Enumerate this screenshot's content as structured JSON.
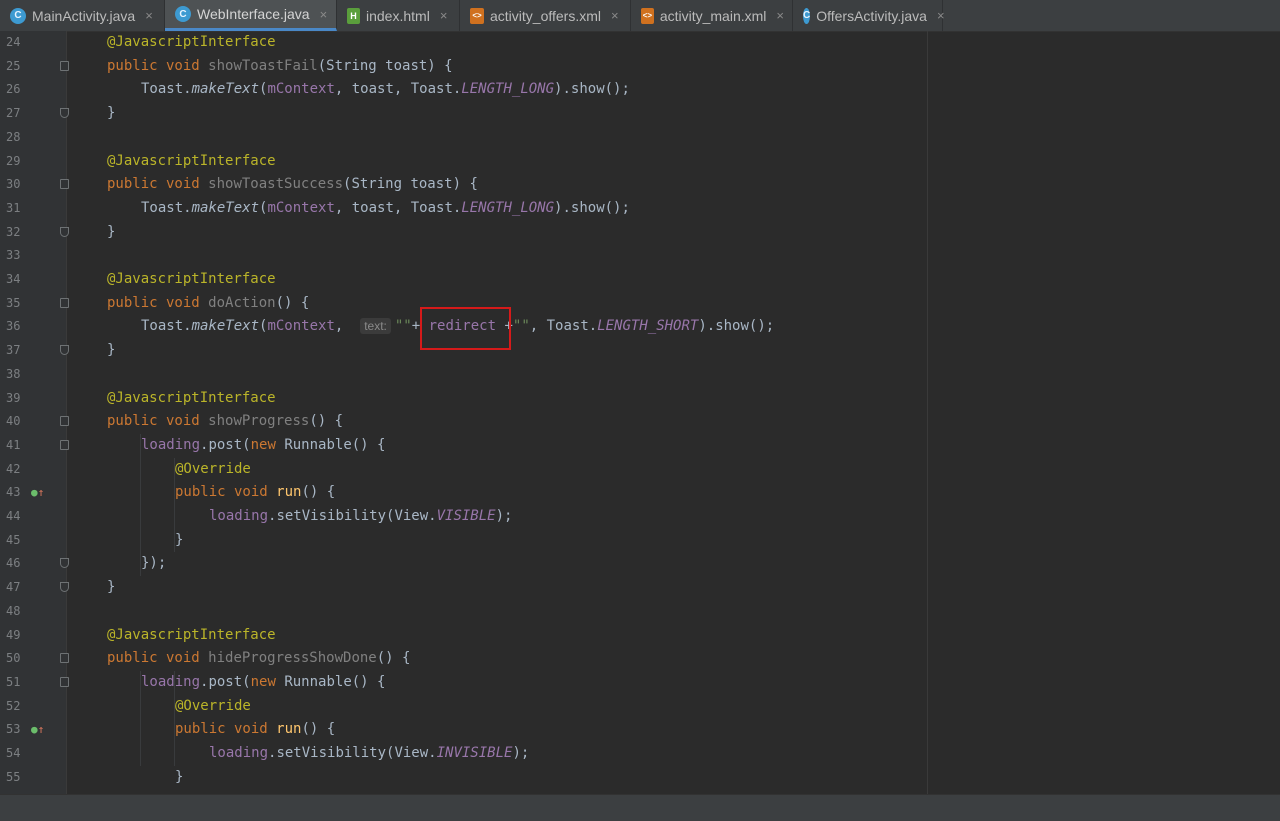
{
  "tabs": [
    {
      "label": "MainActivity.java",
      "icon": "java-class-icon",
      "active": false,
      "closable": true
    },
    {
      "label": "WebInterface.java",
      "icon": "java-class-icon",
      "active": true,
      "closable": true
    },
    {
      "label": "index.html",
      "icon": "html-file-icon",
      "active": false,
      "closable": true
    },
    {
      "label": "activity_offers.xml",
      "icon": "xml-file-icon",
      "active": false,
      "closable": true
    },
    {
      "label": "activity_main.xml",
      "icon": "xml-file-icon",
      "active": false,
      "closable": true
    },
    {
      "label": "OffersActivity.java",
      "icon": "java-class-icon",
      "active": false,
      "closable": true
    }
  ],
  "tab_close_glyph": "×",
  "editor": {
    "hint_text": "text:",
    "lines": [
      {
        "n": "24",
        "fold": "",
        "mark": false,
        "indent": 0,
        "tokens": [
          [
            "ann",
            "@JavascriptInterface"
          ]
        ]
      },
      {
        "n": "25",
        "fold": "start",
        "mark": false,
        "indent": 0,
        "tokens": [
          [
            "kw",
            "public void "
          ],
          [
            "unused",
            "showToastFail"
          ],
          [
            "",
            "(String toast) {"
          ]
        ]
      },
      {
        "n": "26",
        "fold": "",
        "mark": false,
        "indent": 1,
        "tokens": [
          [
            "",
            "Toast."
          ],
          [
            "stat",
            "makeText"
          ],
          [
            "",
            "("
          ],
          [
            "field",
            "mContext"
          ],
          [
            "",
            ", toast, Toast."
          ],
          [
            "sfield",
            "LENGTH_LONG"
          ],
          [
            "",
            ").show();"
          ]
        ]
      },
      {
        "n": "27",
        "fold": "end",
        "mark": false,
        "indent": 0,
        "tokens": [
          [
            "",
            "}"
          ]
        ]
      },
      {
        "n": "28",
        "fold": "",
        "mark": false,
        "indent": 0,
        "tokens": []
      },
      {
        "n": "29",
        "fold": "",
        "mark": false,
        "indent": 0,
        "tokens": [
          [
            "ann",
            "@JavascriptInterface"
          ]
        ]
      },
      {
        "n": "30",
        "fold": "start",
        "mark": false,
        "indent": 0,
        "tokens": [
          [
            "kw",
            "public void "
          ],
          [
            "unused",
            "showToastSuccess"
          ],
          [
            "",
            "(String toast) {"
          ]
        ]
      },
      {
        "n": "31",
        "fold": "",
        "mark": false,
        "indent": 1,
        "tokens": [
          [
            "",
            "Toast."
          ],
          [
            "stat",
            "makeText"
          ],
          [
            "",
            "("
          ],
          [
            "field",
            "mContext"
          ],
          [
            "",
            ", toast, Toast."
          ],
          [
            "sfield",
            "LENGTH_LONG"
          ],
          [
            "",
            ").show();"
          ]
        ]
      },
      {
        "n": "32",
        "fold": "end",
        "mark": false,
        "indent": 0,
        "tokens": [
          [
            "",
            "}"
          ]
        ]
      },
      {
        "n": "33",
        "fold": "",
        "mark": false,
        "indent": 0,
        "tokens": []
      },
      {
        "n": "34",
        "fold": "",
        "mark": false,
        "indent": 0,
        "tokens": [
          [
            "ann",
            "@JavascriptInterface"
          ]
        ]
      },
      {
        "n": "35",
        "fold": "start",
        "mark": false,
        "indent": 0,
        "tokens": [
          [
            "kw",
            "public void "
          ],
          [
            "unused",
            "doAction"
          ],
          [
            "",
            "() {"
          ]
        ]
      },
      {
        "n": "36",
        "fold": "",
        "mark": false,
        "indent": 1,
        "tokens": [
          [
            "",
            "Toast."
          ],
          [
            "stat",
            "makeText"
          ],
          [
            "",
            "("
          ],
          [
            "field",
            "mContext"
          ],
          [
            "",
            ",  "
          ],
          [
            "hint",
            "text:"
          ],
          [
            "str",
            "\"\""
          ],
          [
            "",
            "+ "
          ],
          [
            "field",
            "redirect"
          ],
          [
            "",
            " +"
          ],
          [
            "str",
            "\"\""
          ],
          [
            "",
            ", Toast."
          ],
          [
            "sfield",
            "LENGTH_SHORT"
          ],
          [
            "",
            ").show();"
          ]
        ]
      },
      {
        "n": "37",
        "fold": "end",
        "mark": false,
        "indent": 0,
        "tokens": [
          [
            "",
            "}"
          ]
        ]
      },
      {
        "n": "38",
        "fold": "",
        "mark": false,
        "indent": 0,
        "tokens": []
      },
      {
        "n": "39",
        "fold": "",
        "mark": false,
        "indent": 0,
        "tokens": [
          [
            "ann",
            "@JavascriptInterface"
          ]
        ]
      },
      {
        "n": "40",
        "fold": "start",
        "mark": false,
        "indent": 0,
        "tokens": [
          [
            "kw",
            "public void "
          ],
          [
            "unused",
            "showProgress"
          ],
          [
            "",
            "() {"
          ]
        ]
      },
      {
        "n": "41",
        "fold": "start",
        "mark": false,
        "indent": 1,
        "tokens": [
          [
            "field",
            "loading"
          ],
          [
            "",
            ".post("
          ],
          [
            "kw",
            "new "
          ],
          [
            "",
            "Runnable() {"
          ]
        ]
      },
      {
        "n": "42",
        "fold": "",
        "mark": false,
        "indent": 2,
        "tokens": [
          [
            "ann",
            "@Override"
          ]
        ]
      },
      {
        "n": "43",
        "fold": "",
        "mark": true,
        "indent": 2,
        "tokens": [
          [
            "kw",
            "public void "
          ],
          [
            "meth",
            "run"
          ],
          [
            "",
            "() {"
          ]
        ]
      },
      {
        "n": "44",
        "fold": "",
        "mark": false,
        "indent": 3,
        "tokens": [
          [
            "field",
            "loading"
          ],
          [
            "",
            ".setVisibility(View."
          ],
          [
            "sfield",
            "VISIBLE"
          ],
          [
            "",
            ");"
          ]
        ]
      },
      {
        "n": "45",
        "fold": "",
        "mark": false,
        "indent": 2,
        "tokens": [
          [
            "",
            "}"
          ]
        ]
      },
      {
        "n": "46",
        "fold": "end",
        "mark": false,
        "indent": 1,
        "tokens": [
          [
            "",
            "});"
          ]
        ]
      },
      {
        "n": "47",
        "fold": "end",
        "mark": false,
        "indent": 0,
        "tokens": [
          [
            "",
            "}"
          ]
        ]
      },
      {
        "n": "48",
        "fold": "",
        "mark": false,
        "indent": 0,
        "tokens": []
      },
      {
        "n": "49",
        "fold": "",
        "mark": false,
        "indent": 0,
        "tokens": [
          [
            "ann",
            "@JavascriptInterface"
          ]
        ]
      },
      {
        "n": "50",
        "fold": "start",
        "mark": false,
        "indent": 0,
        "tokens": [
          [
            "kw",
            "public void "
          ],
          [
            "unused",
            "hideProgressShowDone"
          ],
          [
            "",
            "() {"
          ]
        ]
      },
      {
        "n": "51",
        "fold": "start",
        "mark": false,
        "indent": 1,
        "tokens": [
          [
            "field",
            "loading"
          ],
          [
            "",
            ".post("
          ],
          [
            "kw",
            "new "
          ],
          [
            "",
            "Runnable() {"
          ]
        ]
      },
      {
        "n": "52",
        "fold": "",
        "mark": false,
        "indent": 2,
        "tokens": [
          [
            "ann",
            "@Override"
          ]
        ]
      },
      {
        "n": "53",
        "fold": "",
        "mark": true,
        "indent": 2,
        "tokens": [
          [
            "kw",
            "public void "
          ],
          [
            "meth",
            "run"
          ],
          [
            "",
            "() {"
          ]
        ]
      },
      {
        "n": "54",
        "fold": "",
        "mark": false,
        "indent": 3,
        "tokens": [
          [
            "field",
            "loading"
          ],
          [
            "",
            ".setVisibility(View."
          ],
          [
            "sfield",
            "INVISIBLE"
          ],
          [
            "",
            ");"
          ]
        ]
      },
      {
        "n": "55",
        "fold": "",
        "mark": false,
        "indent": 2,
        "tokens": [
          [
            "",
            "}"
          ]
        ]
      }
    ]
  },
  "highlight": {
    "color": "#d51a1a",
    "target": "redirect"
  }
}
